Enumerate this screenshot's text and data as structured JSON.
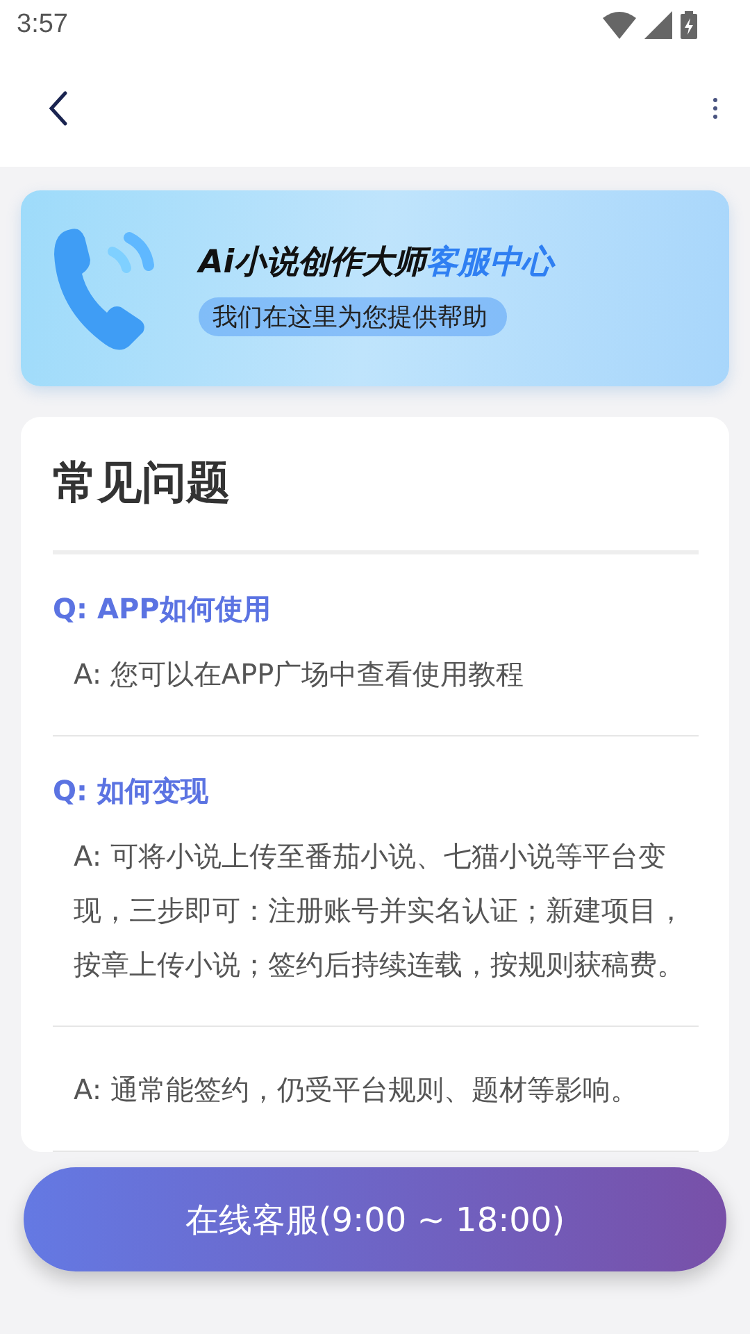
{
  "status_bar": {
    "time": "3:57"
  },
  "banner": {
    "title": "Ai小说创作大师",
    "title_highlight": "客服中心",
    "subtitle": "我们在这里为您提供帮助"
  },
  "faq": {
    "title": "常见问题",
    "items": [
      {
        "question": "Q: APP如何使用",
        "answer": "A: 您可以在APP广场中查看使用教程"
      },
      {
        "question": "Q: 如何变现",
        "answer": "A: 可将小说上传至番茄小说、七猫小说等平台变现，三步即可：注册账号并实名认证；新建项目，按章上传小说；签约后持续连载，按规则获稿费。"
      },
      {
        "answer": "A: 通常能签约，仍受平台规则、题材等影响。"
      }
    ]
  },
  "contact_button": {
    "label": "在线客服(9:00 ~ 18:00)"
  }
}
